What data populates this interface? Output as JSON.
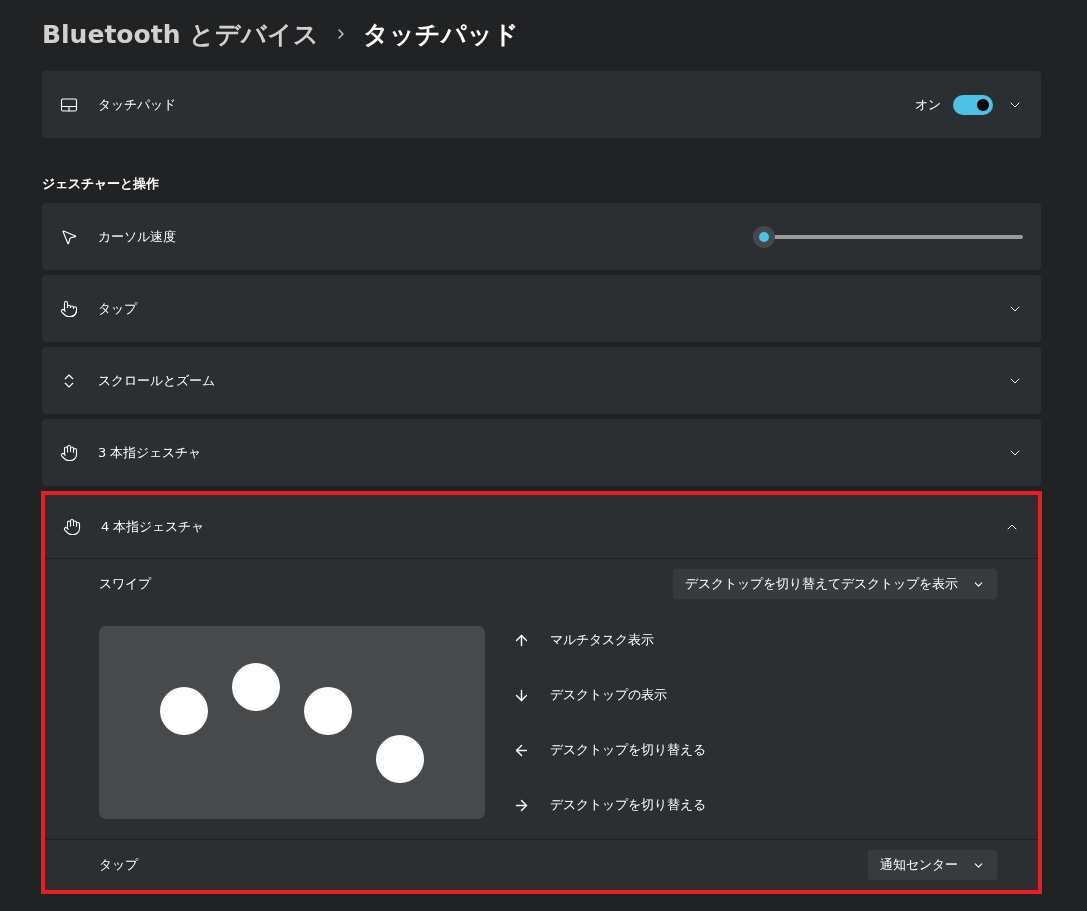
{
  "breadcrumb": {
    "parent": "Bluetooth とデバイス",
    "current": "タッチパッド"
  },
  "touchpad": {
    "label": "タッチパッド",
    "state_text": "オン",
    "on": true,
    "expanded": false
  },
  "section_title": "ジェスチャーと操作",
  "settings": [
    {
      "kind": "slider",
      "label": "カーソル速度",
      "level": 0.0
    },
    {
      "kind": "expander",
      "label": "タップ",
      "expanded": false
    },
    {
      "kind": "expander",
      "label": "スクロールとズーム",
      "expanded": false
    },
    {
      "kind": "expander",
      "label": "3 本指ジェスチャ",
      "expanded": false
    },
    {
      "kind": "expander",
      "label": "4 本指ジェスチャ",
      "expanded": true,
      "highlighted": true,
      "swipe": {
        "label": "スワイプ",
        "value": "デスクトップを切り替えてデスクトップを表示"
      },
      "directions": [
        "マルチタスク表示",
        "デスクトップの表示",
        "デスクトップを切り替える",
        "デスクトップを切り替える"
      ],
      "tap": {
        "label": "タップ",
        "value": "通知センター"
      }
    }
  ]
}
